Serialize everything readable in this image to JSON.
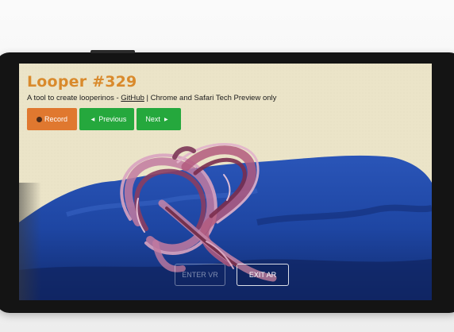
{
  "app": {
    "title": "Looper #329",
    "subtitle_prefix": "A tool to create looperinos - ",
    "github_link": "GitHub",
    "subtitle_suffix": " | Chrome and Safari Tech Preview only"
  },
  "controls": {
    "record_label": "Record",
    "previous_label": "Previous",
    "next_label": "Next",
    "previous_arrow": "◀",
    "next_arrow": "▶"
  },
  "xr": {
    "enter_vr_label": "ENTER VR",
    "exit_ar_label": "EXIT AR"
  },
  "colors": {
    "title": "#d98a2c",
    "record_button": "#e0782f",
    "nav_button": "#25a83d",
    "fabric": "#1c3f9a",
    "wall": "#e9e2c6",
    "loop_tint": "#b35b7e"
  },
  "icons": {
    "record": "record-dot-icon",
    "previous": "triangle-left-icon",
    "next": "triangle-right-icon"
  }
}
